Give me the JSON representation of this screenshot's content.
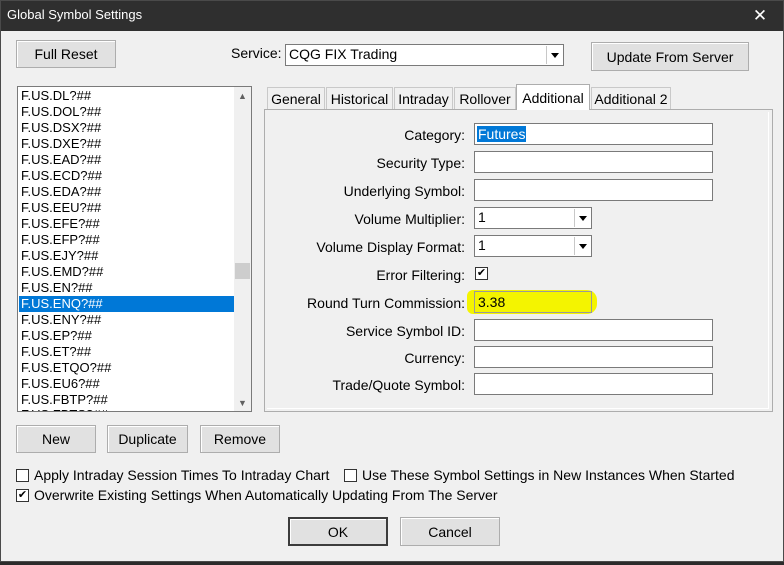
{
  "window": {
    "title": "Global Symbol Settings",
    "close_glyph": "✕"
  },
  "toolbar": {
    "full_reset": "Full Reset",
    "service_label": "Service:",
    "service_value": "CQG FIX Trading",
    "update_from_server": "Update From Server"
  },
  "symbols": [
    "F.US.DL?##",
    "F.US.DOL?##",
    "F.US.DSX?##",
    "F.US.DXE?##",
    "F.US.EAD?##",
    "F.US.ECD?##",
    "F.US.EDA?##",
    "F.US.EEU?##",
    "F.US.EFE?##",
    "F.US.EFP?##",
    "F.US.EJY?##",
    "F.US.EMD?##",
    "F.US.EN?##",
    "F.US.ENQ?##",
    "F.US.ENY?##",
    "F.US.EP?##",
    "F.US.ET?##",
    "F.US.ETQO?##",
    "F.US.EU6?##",
    "F.US.FBTP?##"
  ],
  "selected_symbol": "F.US.ENQ?##",
  "tabs": [
    "General",
    "Historical",
    "Intraday",
    "Rollover",
    "Additional",
    "Additional 2"
  ],
  "active_tab": "Additional",
  "fields": {
    "category": {
      "label": "Category:",
      "value": "Futures"
    },
    "security_type": {
      "label": "Security Type:",
      "value": ""
    },
    "underlying_symbol": {
      "label": "Underlying Symbol:",
      "value": ""
    },
    "volume_multiplier": {
      "label": "Volume Multiplier:",
      "value": "1"
    },
    "volume_display_format": {
      "label": "Volume Display Format:",
      "value": "1"
    },
    "error_filtering": {
      "label": "Error Filtering:",
      "checked": true
    },
    "round_turn_commission": {
      "label": "Round Turn Commission:",
      "value": "3.38"
    },
    "service_symbol_id": {
      "label": "Service Symbol ID:",
      "value": ""
    },
    "currency": {
      "label": "Currency:",
      "value": ""
    },
    "trade_quote_symbol": {
      "label": "Trade/Quote Symbol:",
      "value": ""
    }
  },
  "list_buttons": {
    "new": "New",
    "duplicate": "Duplicate",
    "remove": "Remove"
  },
  "options": {
    "apply_intraday": {
      "label": "Apply Intraday Session Times To Intraday Chart",
      "checked": false
    },
    "use_new_instances": {
      "label": "Use These Symbol Settings in New Instances When Started",
      "checked": false
    },
    "overwrite_existing": {
      "label": "Overwrite Existing Settings When Automatically Updating From The Server",
      "checked": true
    }
  },
  "footer": {
    "ok": "OK",
    "cancel": "Cancel"
  },
  "colors": {
    "selection": "#0078d7",
    "highlight": "#f4f400",
    "titlebar": "#2f2f2f"
  },
  "glyphs": {
    "check": "✔",
    "up": "▲",
    "down": "▼"
  }
}
